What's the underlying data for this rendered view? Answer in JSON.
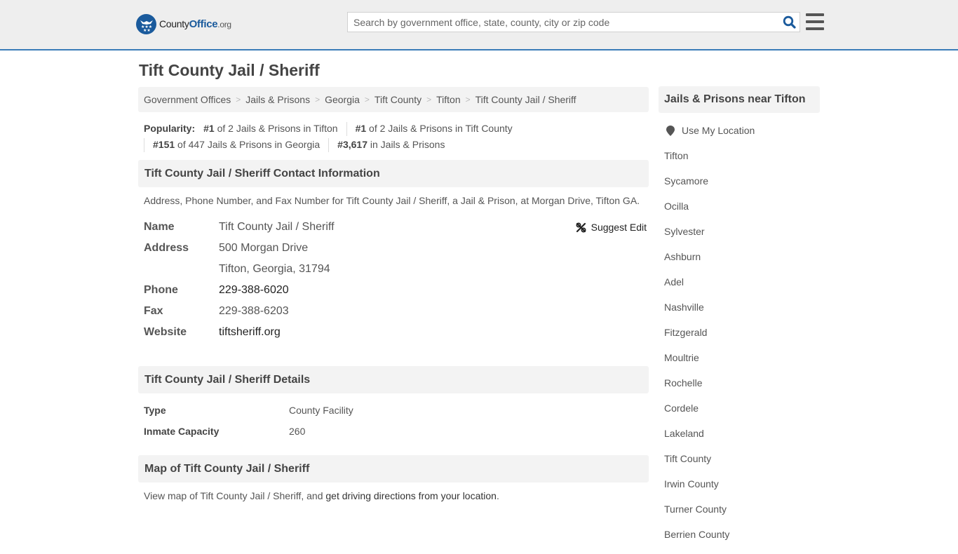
{
  "header": {
    "logo_text_pre": "County",
    "logo_text_brand": "Office",
    "logo_text_tld": ".org",
    "search_placeholder": "Search by government office, state, county, city or zip code",
    "search_value": "",
    "colors": {
      "brand": "#1a5a9c",
      "accent_border": "#3a7cb8",
      "header_bg": "#eeeeee"
    }
  },
  "page_title": "Tift County Jail / Sheriff",
  "breadcrumb": [
    "Government Offices",
    "Jails & Prisons",
    "Georgia",
    "Tift County",
    "Tifton",
    "Tift County Jail / Sheriff"
  ],
  "breadcrumb_separator": ">",
  "popularity": {
    "label": "Popularity:",
    "items": [
      {
        "rank": "#1",
        "text": " of 2 Jails & Prisons in Tifton"
      },
      {
        "rank": "#1",
        "text": " of 2 Jails & Prisons in Tift County"
      },
      {
        "rank": "#151",
        "text": " of 447 Jails & Prisons in Georgia"
      },
      {
        "rank": "#3,617",
        "text": " in Jails & Prisons"
      }
    ]
  },
  "contact": {
    "heading": "Tift County Jail / Sheriff Contact Information",
    "description": "Address, Phone Number, and Fax Number for Tift County Jail / Sheriff, a Jail & Prison, at Morgan Drive, Tifton GA.",
    "suggest_edit": "Suggest Edit",
    "name_label": "Name",
    "name_value": "Tift County Jail / Sheriff",
    "address_label": "Address",
    "address_line1": "500 Morgan Drive",
    "address_line2": "Tifton, Georgia, 31794",
    "phone_label": "Phone",
    "phone_value": "229-388-6020",
    "fax_label": "Fax",
    "fax_value": "229-388-6203",
    "website_label": "Website",
    "website_value": "tiftsheriff.org"
  },
  "details": {
    "heading": "Tift County Jail / Sheriff Details",
    "rows": [
      {
        "label": "Type",
        "value": "County Facility"
      },
      {
        "label": "Inmate Capacity",
        "value": "260"
      }
    ]
  },
  "map": {
    "heading": "Map of Tift County Jail / Sheriff",
    "text_pre": "View map of Tift County Jail / Sheriff, and ",
    "link": "get driving directions from your location",
    "text_post": "."
  },
  "sidebar": {
    "heading": "Jails & Prisons near Tifton",
    "use_location": "Use My Location",
    "links": [
      "Tifton",
      "Sycamore",
      "Ocilla",
      "Sylvester",
      "Ashburn",
      "Adel",
      "Nashville",
      "Fitzgerald",
      "Moultrie",
      "Rochelle",
      "Cordele",
      "Lakeland",
      "Tift County",
      "Irwin County",
      "Turner County",
      "Berrien County"
    ]
  }
}
